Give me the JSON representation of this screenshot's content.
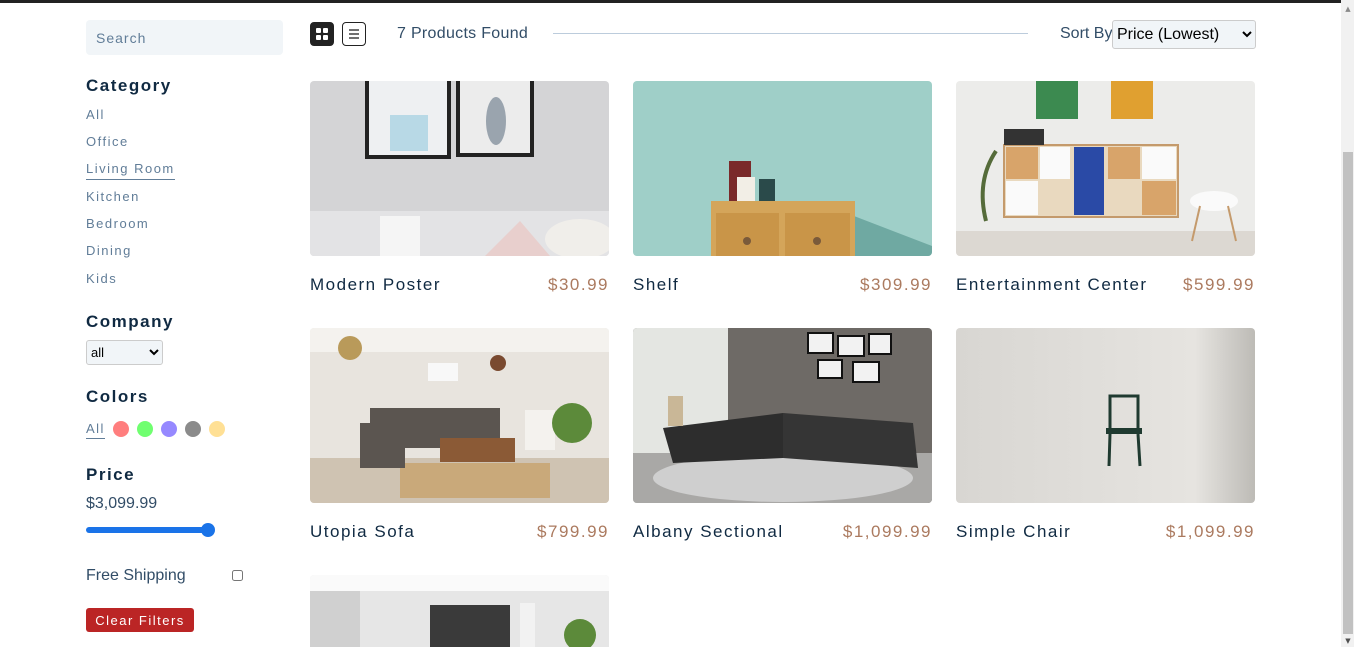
{
  "search": {
    "placeholder": "Search"
  },
  "filters": {
    "category_heading": "Category",
    "categories": [
      "All",
      "Office",
      "Living Room",
      "Kitchen",
      "Bedroom",
      "Dining",
      "Kids"
    ],
    "active_category": "Living Room",
    "company_heading": "Company",
    "company_selected": "all",
    "colors_heading": "Colors",
    "colors_all_label": "All",
    "colors": [
      "#ff5e5e",
      "#4cff4c",
      "#7c6cff",
      "#6e6e6e",
      "#ffd87a"
    ],
    "price_heading": "Price",
    "price_value": "$3,099.99",
    "price_slider_fraction": 1,
    "free_shipping_label": "Free Shipping",
    "free_shipping_checked": false,
    "clear_label": "Clear Filters"
  },
  "toolbar": {
    "count_text": "7 Products Found",
    "sort_label": "Sort By",
    "sort_selected": "Price (Lowest)"
  },
  "products": [
    {
      "name": "Modern Poster",
      "price": "$30.99"
    },
    {
      "name": "Shelf",
      "price": "$309.99"
    },
    {
      "name": "Entertainment Center",
      "price": "$599.99"
    },
    {
      "name": "Utopia Sofa",
      "price": "$799.99"
    },
    {
      "name": "Albany Sectional",
      "price": "$1,099.99"
    },
    {
      "name": "Simple Chair",
      "price": "$1,099.99"
    },
    {
      "name": "",
      "price": ""
    }
  ],
  "theme": {
    "accent": "#ab7a5f",
    "danger": "#bb2525",
    "text": "#324d67",
    "heading": "#102a42",
    "slider": "#1a73e8"
  },
  "icons": {
    "grid_view": "grid-icon",
    "list_view": "list-icon"
  }
}
